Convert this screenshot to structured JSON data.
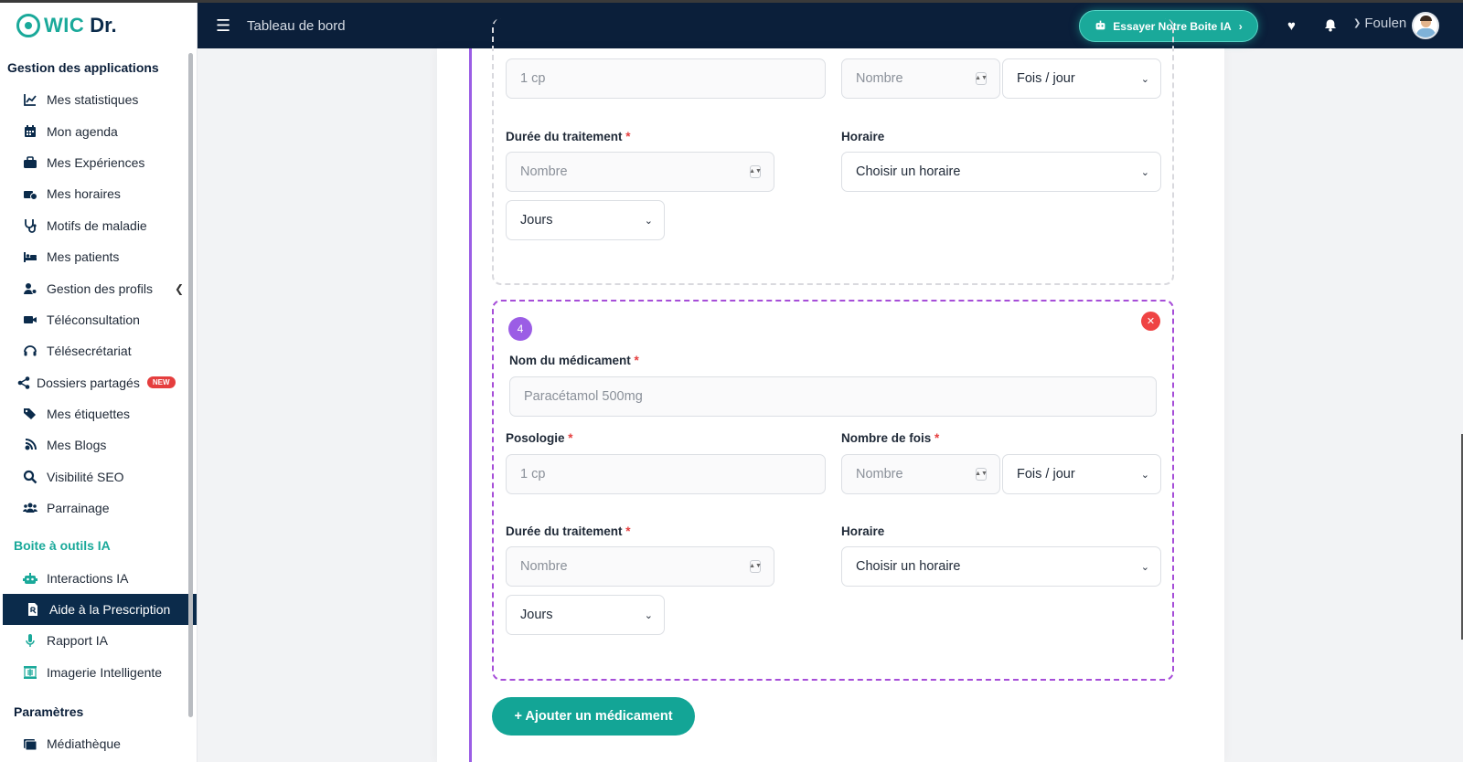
{
  "app": {
    "logo_wic": "WIC",
    "logo_dr": "Dr."
  },
  "header": {
    "title": "Tableau de bord",
    "ai_button": "Essayer Notre Boite IA",
    "user_name": "Foulen"
  },
  "sidebar": {
    "section_apps": "Gestion des applications",
    "items": [
      {
        "label": "Mes statistiques",
        "icon": "chart-line-icon"
      },
      {
        "label": "Mon agenda",
        "icon": "calendar-icon"
      },
      {
        "label": "Mes Expériences",
        "icon": "briefcase-icon"
      },
      {
        "label": "Mes horaires",
        "icon": "clock-icon"
      },
      {
        "label": "Motifs de maladie",
        "icon": "stethoscope-icon"
      },
      {
        "label": "Mes patients",
        "icon": "bed-icon"
      },
      {
        "label": "Gestion des profils",
        "icon": "user-gear-icon"
      },
      {
        "label": "Téléconsultation",
        "icon": "video-icon"
      },
      {
        "label": "Télésecrétariat",
        "icon": "headset-icon"
      },
      {
        "label": "Dossiers partagés",
        "icon": "share-icon",
        "badge": "NEW"
      },
      {
        "label": "Mes étiquettes",
        "icon": "tags-icon"
      },
      {
        "label": "Mes Blogs",
        "icon": "blog-icon"
      },
      {
        "label": "Visibilité SEO",
        "icon": "search-icon"
      },
      {
        "label": "Parrainage",
        "icon": "users-icon"
      }
    ],
    "section_ai": "Boite à outils IA",
    "ai_items": [
      {
        "label": "Interactions IA",
        "icon": "robot-icon"
      },
      {
        "label": "Aide à la Prescription",
        "icon": "file-prescription-icon"
      },
      {
        "label": "Rapport IA",
        "icon": "microphone-icon"
      },
      {
        "label": "Imagerie Intelligente",
        "icon": "xray-icon"
      }
    ],
    "section_params": "Paramètres",
    "params_items": [
      {
        "label": "Médiathèque",
        "icon": "photo-video-icon"
      }
    ]
  },
  "form": {
    "prev": {
      "posologie_value": "1 cp",
      "nombre_placeholder": "Nombre",
      "freq_value": "Fois / jour",
      "duree_label": "Durée du traitement",
      "duree_placeholder": "Nombre",
      "horaire_label": "Horaire",
      "horaire_value": "Choisir un horaire",
      "unit_value": "Jours"
    },
    "curr": {
      "index": "4",
      "nom_label": "Nom du médicament",
      "nom_placeholder": "Paracétamol 500mg",
      "posologie_label": "Posologie",
      "posologie_value": "1 cp",
      "nombre_fois_label": "Nombre de fois",
      "nombre_placeholder": "Nombre",
      "freq_value": "Fois / jour",
      "duree_label": "Durée du traitement",
      "duree_placeholder": "Nombre",
      "horaire_label": "Horaire",
      "horaire_value": "Choisir un horaire",
      "unit_value": "Jours"
    },
    "required_mark": "*",
    "add_button": "+ Ajouter un médicament"
  }
}
